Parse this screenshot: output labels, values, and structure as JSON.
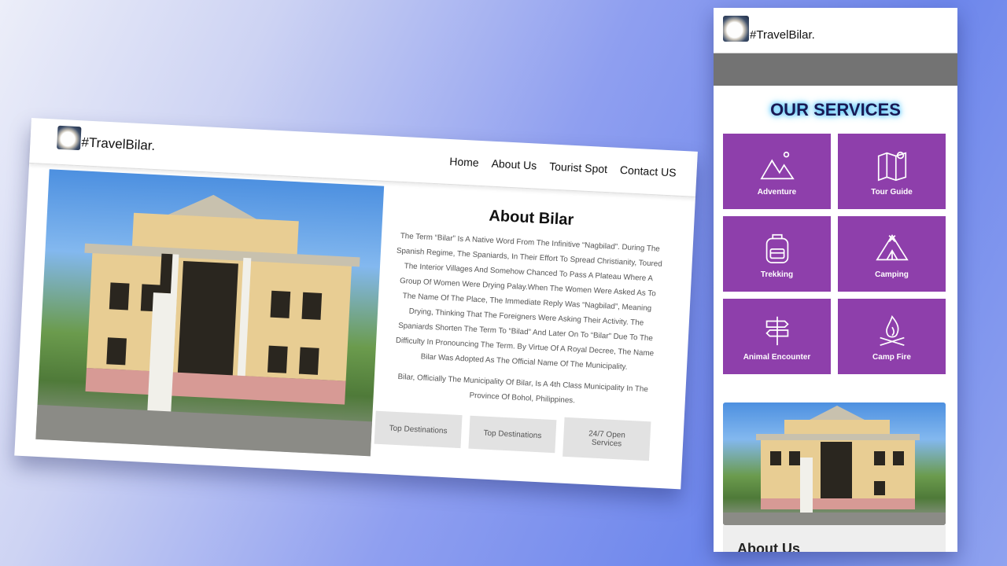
{
  "desktop": {
    "brand": "#TravelBilar.",
    "logo_icon": "globe-logo-icon",
    "menu": [
      "Home",
      "About Us",
      "Tourist Spot",
      "Contact US"
    ],
    "about_title": "About Bilar",
    "about_paragraphs": [
      "The Term “Bilar” Is A Native Word From The Infinitive “Nagbilad”. During The Spanish Regime, The Spaniards, In Their Effort To Spread Christianity, Toured The Interior Villages And Somehow Chanced To Pass A Plateau Where A Group Of Women Were Drying Palay.When The Women Were Asked As To The Name Of The Place, The Immediate Reply Was “Nagbilad”, Meaning Drying, Thinking That The Foreigners Were Asking Their Activity. The Spaniards Shorten The Term To “Bilad” And Later On To “Bilar” Due To The Difficulty In Pronouncing The Term. By Virtue Of A Royal Decree, The Name Bilar Was Adopted As The Official Name Of The Municipality.",
      "Bilar, Officially The Municipality Of Bilar, Is A 4th Class Municipality In The Province Of Bohol, Philippines."
    ],
    "features": [
      "Top Destinations",
      "Top Destinations",
      "24/7 Open Services"
    ]
  },
  "mobile": {
    "brand": "#TravelBilar.",
    "services_title": "OUR SERVICES",
    "services": [
      {
        "label": "Adventure",
        "icon": "mountains-icon"
      },
      {
        "label": "Tour Guide",
        "icon": "map-pin-icon"
      },
      {
        "label": "Trekking",
        "icon": "backpack-icon"
      },
      {
        "label": "Camping",
        "icon": "tent-icon"
      },
      {
        "label": "Animal Encounter",
        "icon": "signpost-icon"
      },
      {
        "label": "Camp Fire",
        "icon": "campfire-icon"
      }
    ],
    "about_title_partial": "About Us"
  },
  "colors": {
    "tile": "#8e3fab",
    "services_glow": "#49c4ff",
    "grey_bar": "#737373"
  }
}
